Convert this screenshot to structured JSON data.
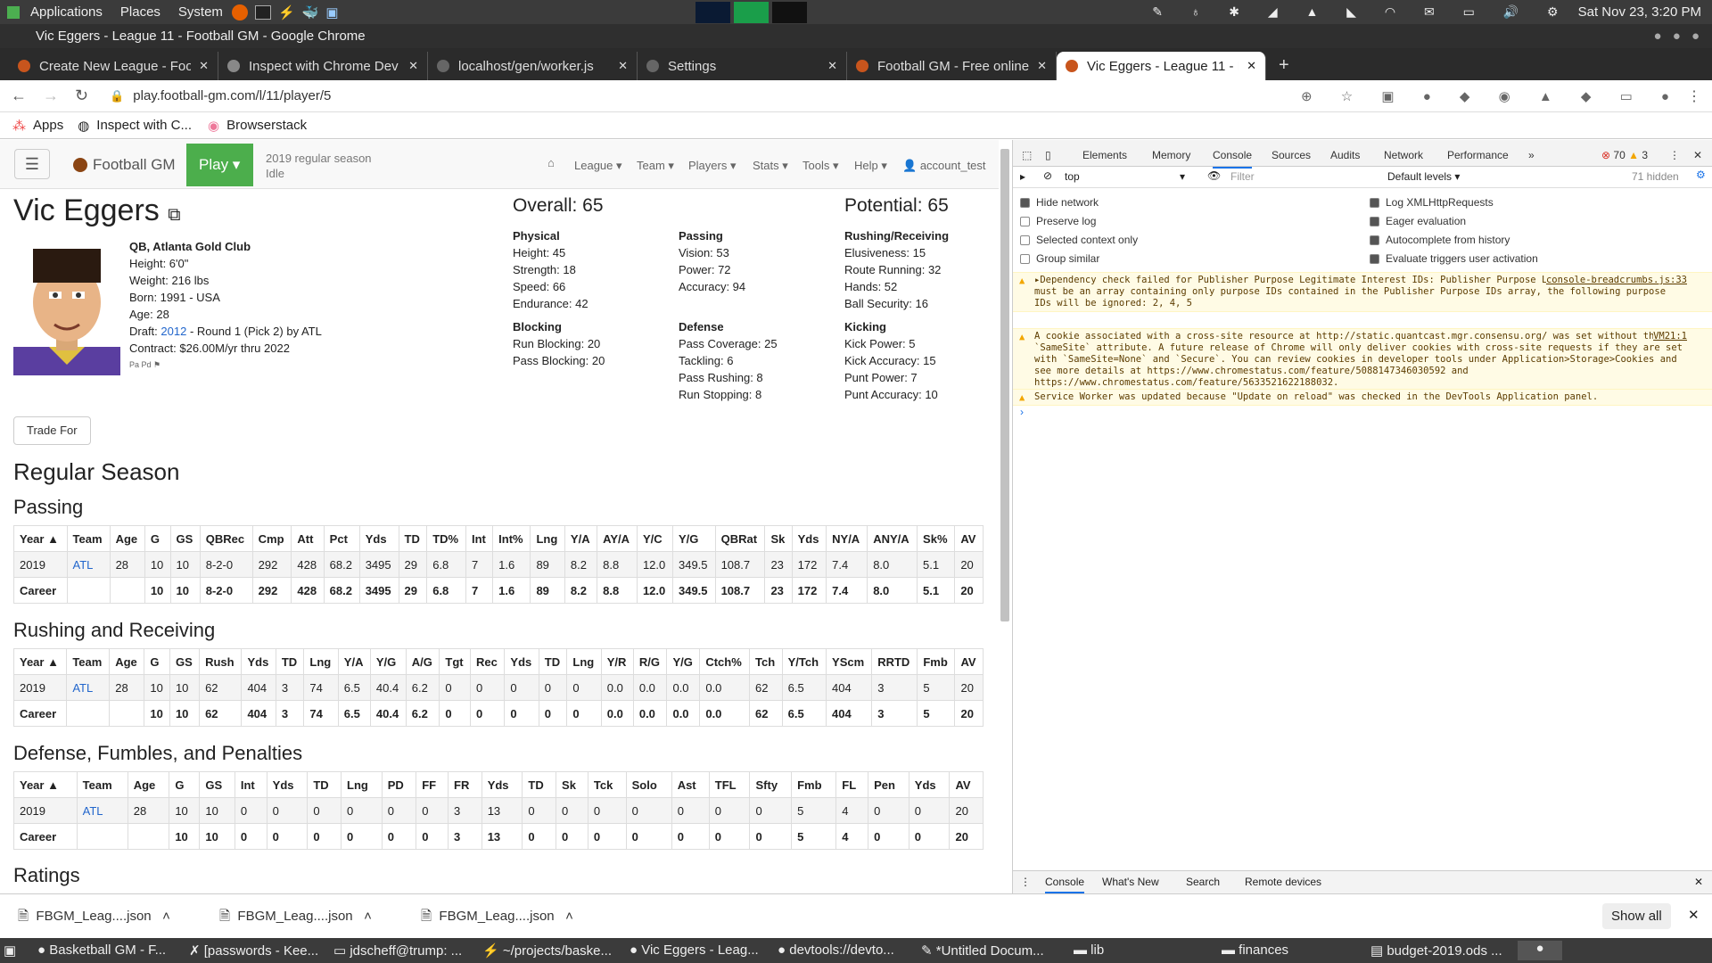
{
  "os": {
    "menus": [
      "Applications",
      "Places",
      "System"
    ],
    "clock": "Sat Nov 23, 3:20 PM"
  },
  "window_title": "Vic Eggers - League 11 - Football GM - Google Chrome",
  "tabs": [
    "Create New League - Foot",
    "Inspect with Chrome Dev",
    "localhost/gen/worker.js",
    "Settings",
    "Football GM - Free online",
    "Vic Eggers - League 11 - Fo"
  ],
  "url": "play.football-gm.com/l/11/player/5",
  "bookmarks": [
    "Apps",
    "Inspect with C...",
    "Browserstack"
  ],
  "nav": {
    "brand": "Football GM",
    "play": "Play",
    "season": "2019 regular season",
    "status": "Idle",
    "menus": [
      "League",
      "Team",
      "Players",
      "Stats",
      "Tools",
      "Help"
    ],
    "account": "account_test"
  },
  "player": {
    "name": "Vic Eggers",
    "pos_team": "QB, Atlanta Gold Club",
    "height": "Height: 6'0\"",
    "weight": "Weight: 216 lbs",
    "born": "Born: 1991 - USA",
    "age": "Age: 28",
    "draft_pre": "Draft:",
    "draft_year": "2012",
    "draft_post": "- Round 1 (Pick 2) by ATL",
    "contract": "Contract: $26.00M/yr thru 2022",
    "tags": "Pa Pd",
    "overall": "Overall: 65",
    "potential": "Potential: 65",
    "trade": "Trade For"
  },
  "ratings": {
    "physical": {
      "title": "Physical",
      "items": [
        "Height: 45",
        "Strength: 18",
        "Speed: 66",
        "Endurance: 42"
      ]
    },
    "passing": {
      "title": "Passing",
      "items": [
        "Vision: 53",
        "Power: 72",
        "Accuracy: 94"
      ]
    },
    "rushing": {
      "title": "Rushing/Receiving",
      "items": [
        "Elusiveness: 15",
        "Route Running: 32",
        "Hands: 52",
        "Ball Security: 16"
      ]
    },
    "blocking": {
      "title": "Blocking",
      "items": [
        "Run Blocking: 20",
        "Pass Blocking: 20"
      ]
    },
    "defense": {
      "title": "Defense",
      "items": [
        "Pass Coverage: 25",
        "Tackling: 6",
        "Pass Rushing: 8",
        "Run Stopping: 8"
      ]
    },
    "kicking": {
      "title": "Kicking",
      "items": [
        "Kick Power: 5",
        "Kick Accuracy: 15",
        "Punt Power: 7",
        "Punt Accuracy: 10"
      ]
    }
  },
  "sections": {
    "regular": "Regular Season",
    "passing": "Passing",
    "rushing": "Rushing and Receiving",
    "defense": "Defense, Fumbles, and Penalties",
    "ratings": "Ratings"
  },
  "passing_table": {
    "headers": [
      "Year",
      "Team",
      "Age",
      "G",
      "GS",
      "QBRec",
      "Cmp",
      "Att",
      "Pct",
      "Yds",
      "TD",
      "TD%",
      "Int",
      "Int%",
      "Lng",
      "Y/A",
      "AY/A",
      "Y/C",
      "Y/G",
      "QBRat",
      "Sk",
      "Yds",
      "NY/A",
      "ANY/A",
      "Sk%",
      "AV"
    ],
    "rows": [
      [
        "2019",
        "ATL",
        "28",
        "10",
        "10",
        "8-2-0",
        "292",
        "428",
        "68.2",
        "3495",
        "29",
        "6.8",
        "7",
        "1.6",
        "89",
        "8.2",
        "8.8",
        "12.0",
        "349.5",
        "108.7",
        "23",
        "172",
        "7.4",
        "8.0",
        "5.1",
        "20"
      ],
      [
        "Career",
        "",
        "",
        "10",
        "10",
        "8-2-0",
        "292",
        "428",
        "68.2",
        "3495",
        "29",
        "6.8",
        "7",
        "1.6",
        "89",
        "8.2",
        "8.8",
        "12.0",
        "349.5",
        "108.7",
        "23",
        "172",
        "7.4",
        "8.0",
        "5.1",
        "20"
      ]
    ]
  },
  "rushing_table": {
    "headers": [
      "Year",
      "Team",
      "Age",
      "G",
      "GS",
      "Rush",
      "Yds",
      "TD",
      "Lng",
      "Y/A",
      "Y/G",
      "A/G",
      "Tgt",
      "Rec",
      "Yds",
      "TD",
      "Lng",
      "Y/R",
      "R/G",
      "Y/G",
      "Ctch%",
      "Tch",
      "Y/Tch",
      "YScm",
      "RRTD",
      "Fmb",
      "AV"
    ],
    "rows": [
      [
        "2019",
        "ATL",
        "28",
        "10",
        "10",
        "62",
        "404",
        "3",
        "74",
        "6.5",
        "40.4",
        "6.2",
        "0",
        "0",
        "0",
        "0",
        "0",
        "0.0",
        "0.0",
        "0.0",
        "0.0",
        "62",
        "6.5",
        "404",
        "3",
        "5",
        "20"
      ],
      [
        "Career",
        "",
        "",
        "10",
        "10",
        "62",
        "404",
        "3",
        "74",
        "6.5",
        "40.4",
        "6.2",
        "0",
        "0",
        "0",
        "0",
        "0",
        "0.0",
        "0.0",
        "0.0",
        "0.0",
        "62",
        "6.5",
        "404",
        "3",
        "5",
        "20"
      ]
    ]
  },
  "defense_table": {
    "headers": [
      "Year",
      "Team",
      "Age",
      "G",
      "GS",
      "Int",
      "Yds",
      "TD",
      "Lng",
      "PD",
      "FF",
      "FR",
      "Yds",
      "TD",
      "Sk",
      "Tck",
      "Solo",
      "Ast",
      "TFL",
      "Sfty",
      "Fmb",
      "FL",
      "Pen",
      "Yds",
      "AV"
    ],
    "rows": [
      [
        "2019",
        "ATL",
        "28",
        "10",
        "10",
        "0",
        "0",
        "0",
        "0",
        "0",
        "0",
        "3",
        "13",
        "0",
        "0",
        "0",
        "0",
        "0",
        "0",
        "0",
        "5",
        "4",
        "0",
        "0",
        "20"
      ],
      [
        "Career",
        "",
        "",
        "10",
        "10",
        "0",
        "0",
        "0",
        "0",
        "0",
        "0",
        "3",
        "13",
        "0",
        "0",
        "0",
        "0",
        "0",
        "0",
        "0",
        "5",
        "4",
        "0",
        "0",
        "20"
      ]
    ]
  },
  "devtools": {
    "tabs": [
      "Elements",
      "Memory",
      "Console",
      "Sources",
      "Audits",
      "Network",
      "Performance"
    ],
    "errors": "70",
    "warnings": "3",
    "context": "top",
    "filter_placeholder": "Filter",
    "levels": "Default levels",
    "hidden": "71 hidden",
    "left_opts": [
      {
        "label": "Hide network",
        "on": true
      },
      {
        "label": "Preserve log",
        "on": false
      },
      {
        "label": "Selected context only",
        "on": false
      },
      {
        "label": "Group similar",
        "on": false
      }
    ],
    "right_opts": [
      {
        "label": "Log XMLHttpRequests",
        "on": true
      },
      {
        "label": "Eager evaluation",
        "on": true
      },
      {
        "label": "Autocomplete from history",
        "on": true
      },
      {
        "label": "Evaluate triggers user activation",
        "on": true
      }
    ],
    "messages": [
      {
        "text": "▸Dependency check failed for Publisher Purpose Legitimate Interest IDs: Publisher Purpose Legitimate Interest IDs must be an array containing only purpose IDs contained in the Publisher Purpose IDs array, the following purpose IDs will be ignored: 2, 4, 5",
        "src": "console-breadcrumbs.js:33"
      },
      {
        "text": "A cookie associated with a cross-site resource at http://static.quantcast.mgr.consensu.org/ was set without the `SameSite` attribute. A future release of Chrome will only deliver cookies with cross-site requests if they are set with `SameSite=None` and `Secure`. You can review cookies in developer tools under Application>Storage>Cookies and see more details at https://www.chromestatus.com/feature/5088147346030592 and https://www.chromestatus.com/feature/5633521622188032.",
        "src": "VM21:1"
      },
      {
        "text": "Service Worker was updated because \"Update on reload\" was checked in the DevTools Application panel.",
        "src": ""
      }
    ],
    "drawer": [
      "Console",
      "What's New",
      "Search",
      "Remote devices"
    ]
  },
  "downloads": [
    "FBGM_Leag....json",
    "FBGM_Leag....json",
    "FBGM_Leag....json"
  ],
  "show_all": "Show all",
  "taskbar": [
    "Basketball GM - F...",
    "[passwords - Kee...",
    "jdscheff@trump: ...",
    "~/projects/baske...",
    "Vic Eggers - Leag...",
    "devtools://devto...",
    "*Untitled Docum...",
    "lib",
    "finances",
    "budget-2019.ods ..."
  ]
}
